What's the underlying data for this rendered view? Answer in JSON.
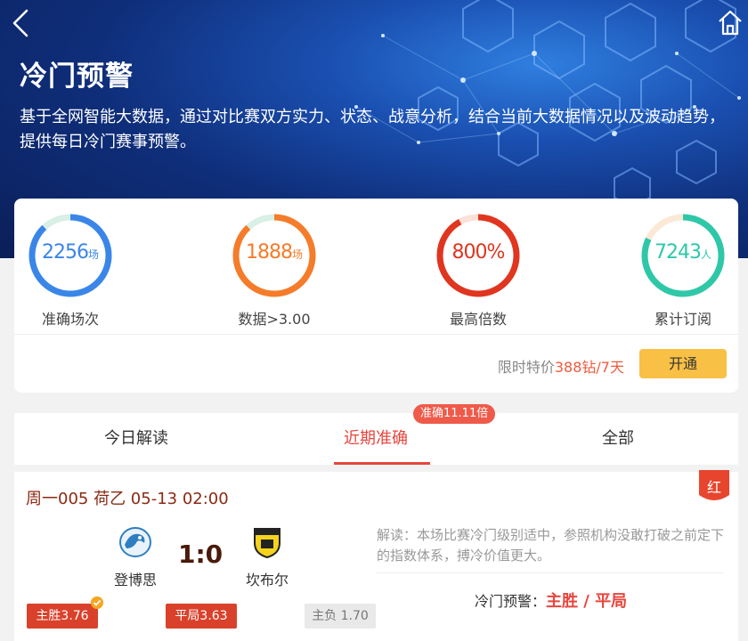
{
  "header": {
    "title": "冷门预警",
    "description": "基于全网智能大数据，通过对比赛双方实力、状态、战意分析，结合当前大数据情况以及波动趋势，提供每日冷门赛事预警。"
  },
  "stats": [
    {
      "value": "2256",
      "unit": "场",
      "label": "准确场次",
      "color": "#3a86e8",
      "progress": 0.88
    },
    {
      "value": "1888",
      "unit": "场",
      "label": "数据>3.00",
      "color": "#f57c2a",
      "progress": 0.88
    },
    {
      "value": "800%",
      "unit": "",
      "label": "最高倍数",
      "color": "#e0351f",
      "progress": 0.92
    },
    {
      "value": "7243",
      "unit": "人",
      "label": "累计订阅",
      "color": "#2ec8a8",
      "progress": 0.82
    }
  ],
  "promo": {
    "prefix": "限时特价",
    "price": "388钻/7天",
    "button_label": "开通"
  },
  "tabs": [
    {
      "label": "今日解读",
      "active": false
    },
    {
      "label": "近期准确",
      "active": true
    },
    {
      "label": "全部",
      "active": false
    }
  ],
  "tab_badge": "准确11.11倍",
  "match": {
    "header": "周一005 荷乙 05-13 02:00",
    "result_flag": "红",
    "home_team": "登博思",
    "away_team": "坎布尔",
    "score": "1:0",
    "analysis": "解读：本场比赛冷门级别适中，参照机构没敢打破之前定下的指数体系，搏冷价值更大。",
    "warning_label": "冷门预警：",
    "warning_value": "主胜 / 平局",
    "odds": [
      {
        "label": "主胜3.76",
        "highlighted": true,
        "checked": true
      },
      {
        "label": "平局3.63",
        "highlighted": true,
        "checked": false
      },
      {
        "label": "主负 1.70",
        "highlighted": false,
        "checked": false
      }
    ]
  },
  "icons": {
    "back": "chevron-left-icon",
    "home": "home-icon",
    "home_team_logo": "dragon-crest-icon",
    "away_team_logo": "yellow-shield-crest-icon"
  }
}
